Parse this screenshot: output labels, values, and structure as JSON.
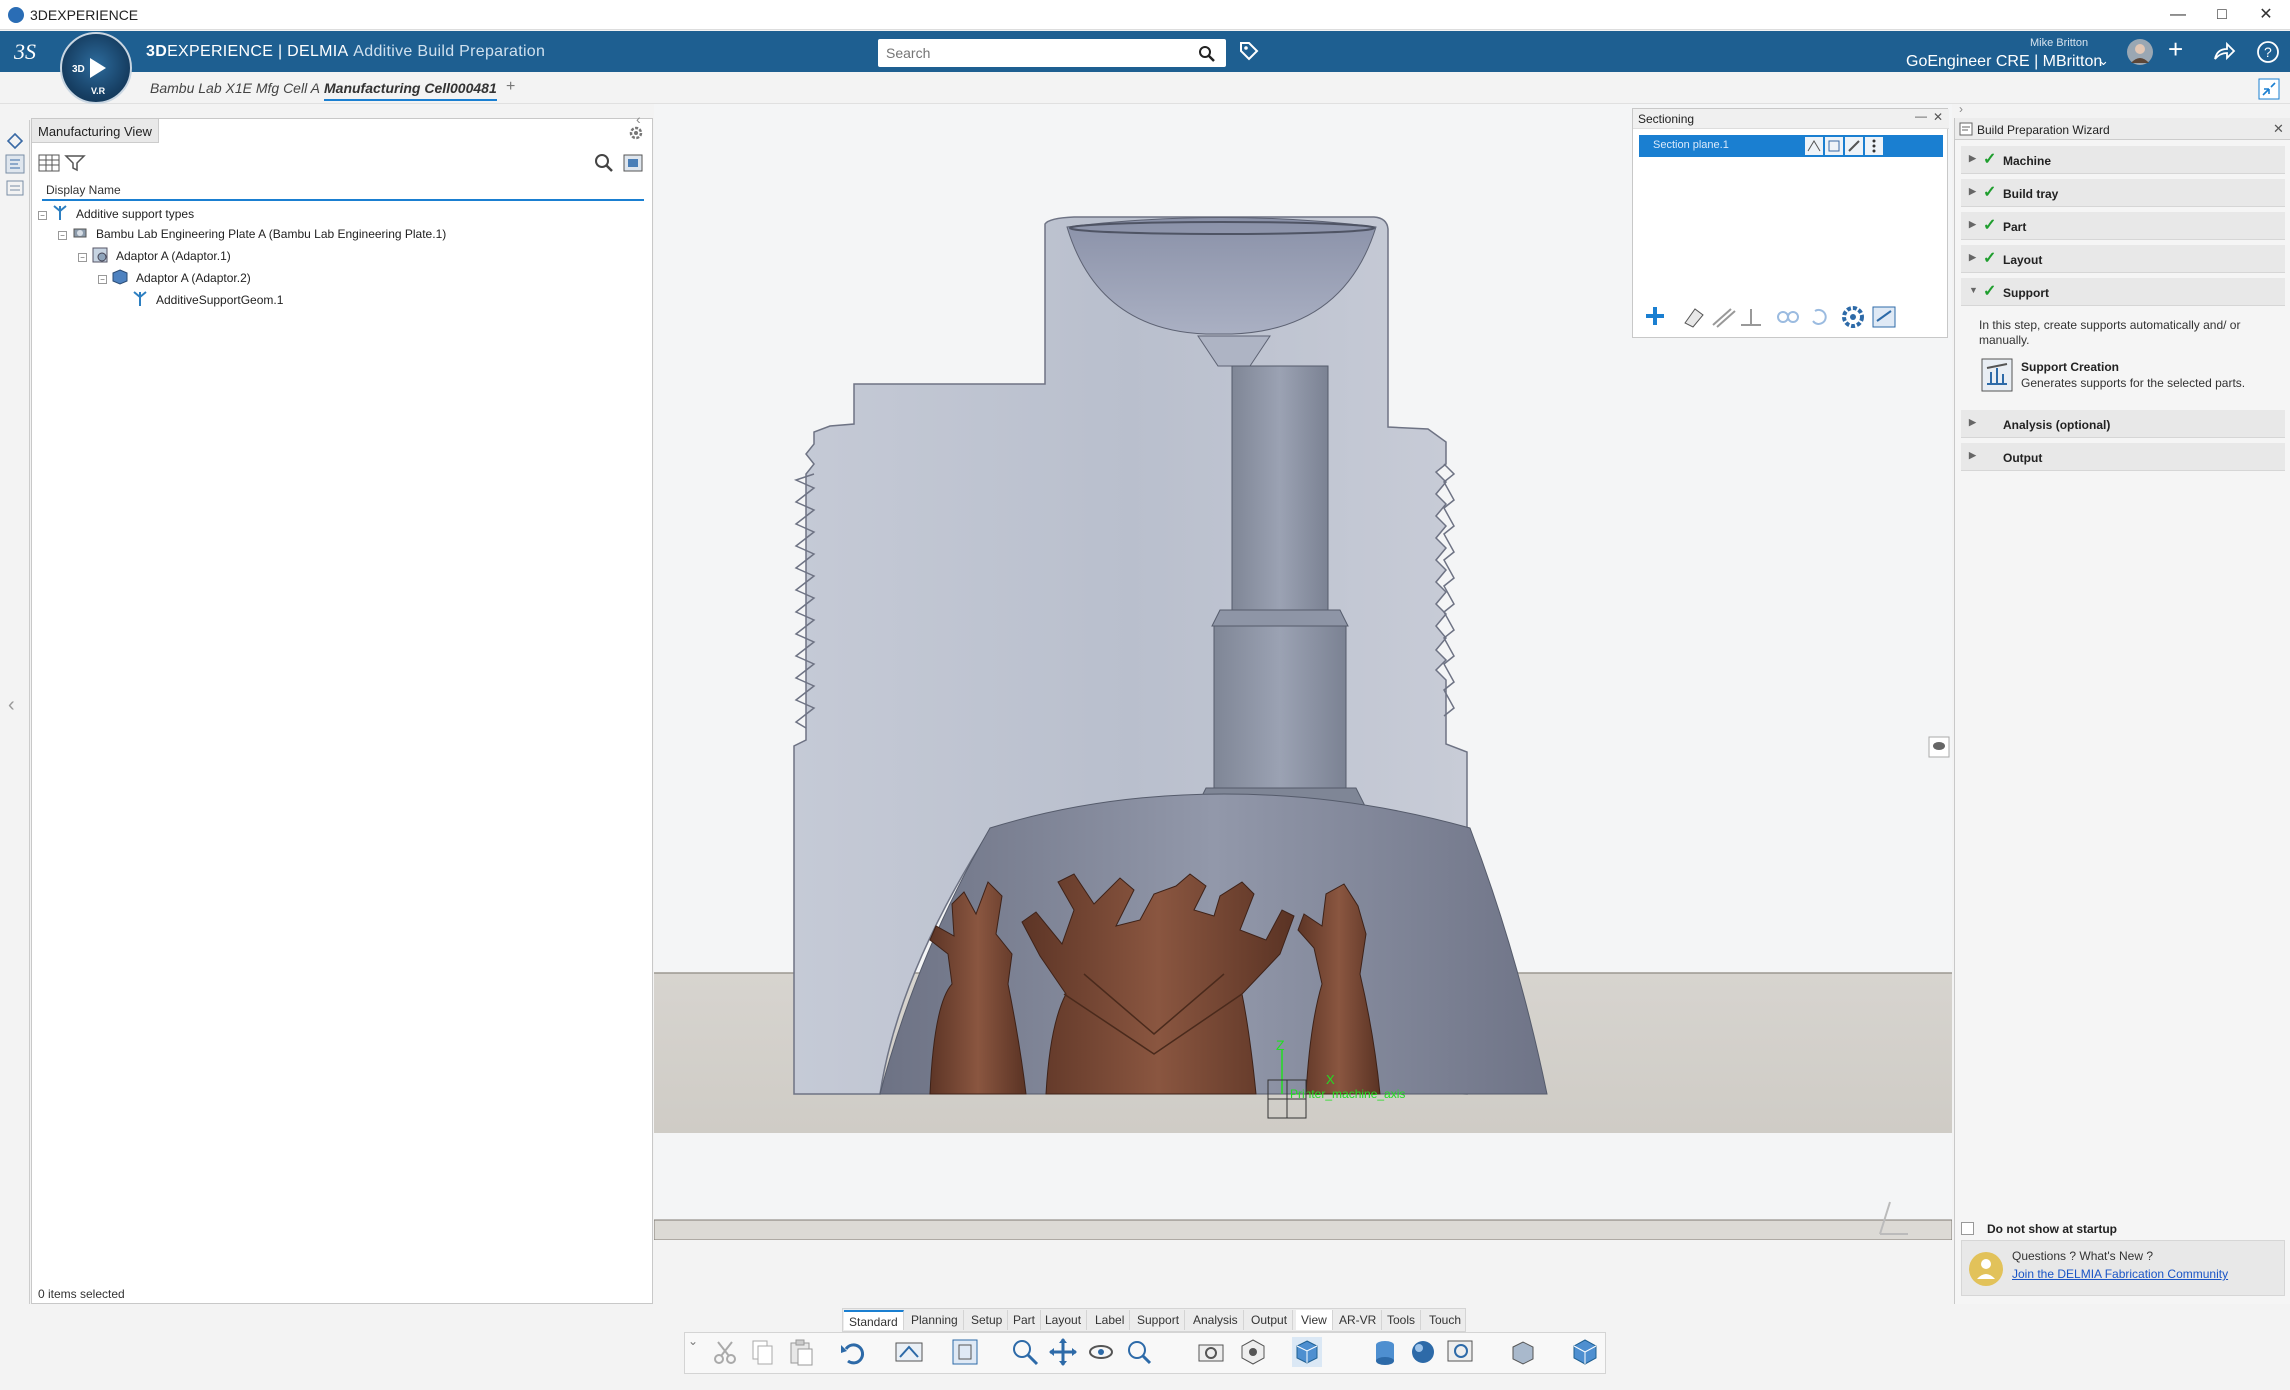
{
  "window": {
    "title": "3DEXPERIENCE"
  },
  "header": {
    "brand_3d": "3D",
    "brand_experience": "EXPERIENCE | DELMIA",
    "brand_app": "Additive Build Preparation",
    "search_placeholder": "Search",
    "user_name": "Mike Britton",
    "user_tenant": "GoEngineer CRE | MBritton",
    "compass_3d": "3D",
    "compass_vr": "V.R"
  },
  "tabs": [
    {
      "label": "Bambu Lab X1E Mfg Cell A"
    },
    {
      "label": "Manufacturing Cell000481"
    }
  ],
  "tabs_add": "+",
  "left_panel": {
    "tab_label": "Manufacturing View",
    "column_header": "Display Name",
    "tree": [
      {
        "label": "Additive support types"
      },
      {
        "label": "Bambu Lab Engineering Plate A (Bambu Lab Engineering Plate.1)"
      },
      {
        "label": "Adaptor A (Adaptor.1)"
      },
      {
        "label": "Adaptor A (Adaptor.2)"
      },
      {
        "label": "AdditiveSupportGeom.1"
      }
    ],
    "status": "0 items selected"
  },
  "sectioning": {
    "title": "Sectioning",
    "plane": "Section plane.1"
  },
  "viewport": {
    "axis_z": "Z",
    "axis_x": "X",
    "axis_label": "Printer_machine_axis"
  },
  "wizard": {
    "title": "Build Preparation Wizard",
    "steps": [
      {
        "label": "Machine"
      },
      {
        "label": "Build tray"
      },
      {
        "label": "Part"
      },
      {
        "label": "Layout"
      },
      {
        "label": "Support"
      },
      {
        "label": "Analysis (optional)"
      },
      {
        "label": "Output"
      }
    ],
    "support_text": "In this step, create supports automatically and/ or manually.",
    "support_creation_title": "Support Creation",
    "support_creation_desc": "Generates supports for the selected parts.",
    "startup_label": "Do not show at startup",
    "questions": "Questions ? What's New ?",
    "community_link": "Join the DELMIA Fabrication Community"
  },
  "workbench_tabs": [
    {
      "label": "Standard"
    },
    {
      "label": "Planning"
    },
    {
      "label": "Setup"
    },
    {
      "label": "Part"
    },
    {
      "label": "Layout"
    },
    {
      "label": "Label"
    },
    {
      "label": "Support"
    },
    {
      "label": "Analysis"
    },
    {
      "label": "Output"
    },
    {
      "label": "View"
    },
    {
      "label": "AR-VR"
    },
    {
      "label": "Tools"
    },
    {
      "label": "Touch"
    }
  ],
  "colors": {
    "header": "#1e5f91",
    "part": "#b7bccb",
    "support": "#7a4a35",
    "accent": "#1a7fd1"
  }
}
